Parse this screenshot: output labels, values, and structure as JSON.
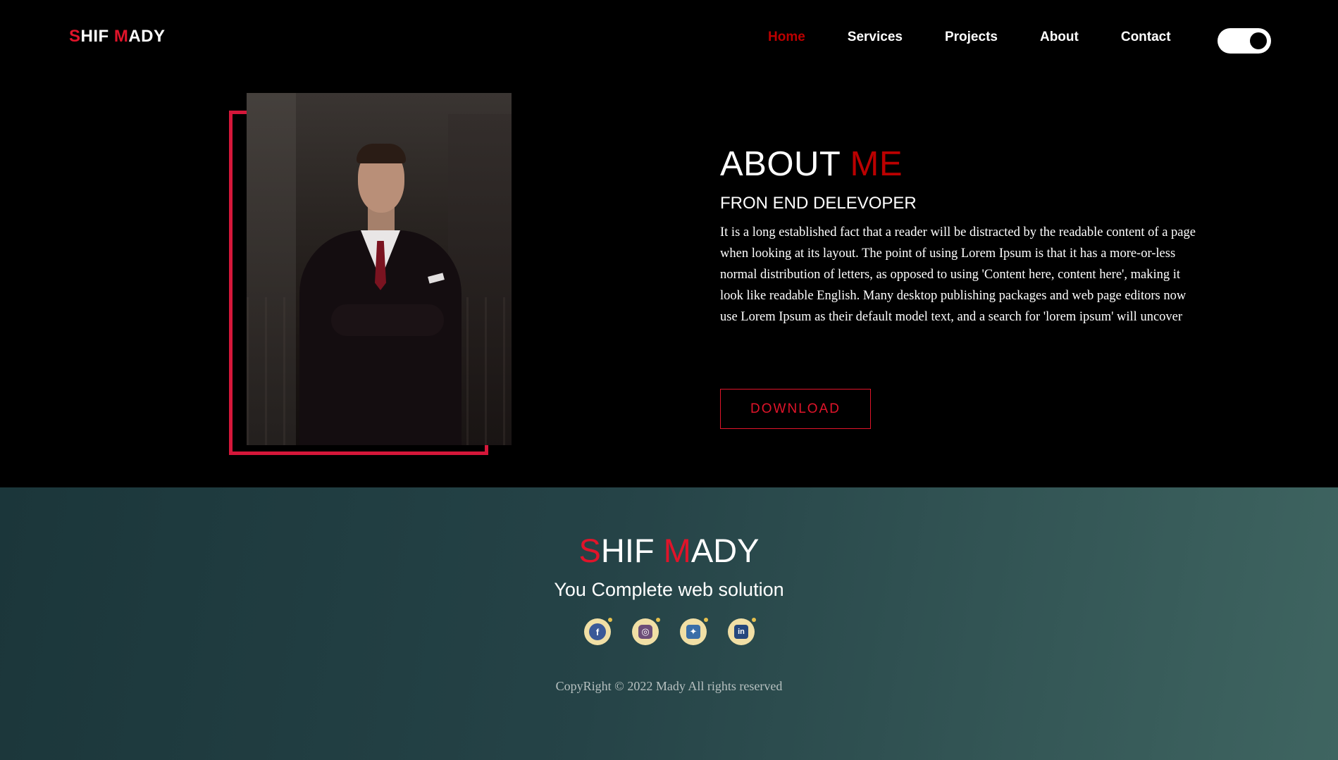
{
  "brand": {
    "first_initial": "S",
    "first_rest": "HIF ",
    "second_initial": "M",
    "second_rest": "ADY"
  },
  "nav": {
    "items": [
      {
        "label": "Home",
        "active": true
      },
      {
        "label": "Services",
        "active": false
      },
      {
        "label": "Projects",
        "active": false
      },
      {
        "label": "About",
        "active": false
      },
      {
        "label": "Contact",
        "active": false
      }
    ],
    "theme_toggle": "dark"
  },
  "about": {
    "title_main": "ABOUT ",
    "title_accent": "ME",
    "role": "FRON END DELEVOPER",
    "description": "It is a long established fact that a reader will be distracted by the readable content of a page when looking at its layout. The point of using Lorem Ipsum is that it has a more-or-less normal distribution of letters, as opposed to using 'Content here, content here', making it look like readable English. Many desktop publishing packages and web page editors now use Lorem Ipsum as their default model text, and a search for 'lorem ipsum' will uncover",
    "download_label": "DOWNLOAD"
  },
  "footer": {
    "tagline": "You Complete web solution",
    "socials": [
      {
        "icon": "facebook-icon",
        "glyph": "f"
      },
      {
        "icon": "instagram-icon",
        "glyph": "◎"
      },
      {
        "icon": "twitter-icon",
        "glyph": "✦"
      },
      {
        "icon": "linkedin-icon",
        "glyph": "in"
      }
    ],
    "copyright": "CopyRight © 2022 Mady All rights reserved"
  },
  "colors": {
    "accent": "#e0142a",
    "active_nav": "#bb0000",
    "frame": "#d5173a",
    "footer_start": "#1b363a",
    "footer_end": "#3f6561"
  }
}
